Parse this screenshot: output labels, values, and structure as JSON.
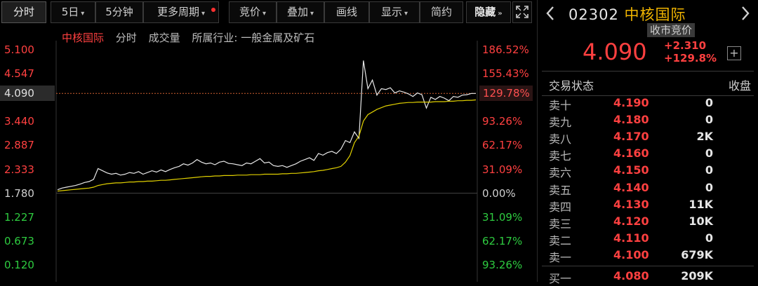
{
  "toolbar": {
    "items": [
      {
        "label": "分时"
      },
      {
        "label": "5日",
        "caret": "▾"
      },
      {
        "label": "5分钟"
      },
      {
        "label": "更多周期",
        "caret": "▾"
      },
      {
        "label": "竞价",
        "caret": "▾"
      },
      {
        "label": "叠加",
        "caret": "▾"
      },
      {
        "label": "画线"
      },
      {
        "label": "显示",
        "caret": "▾"
      },
      {
        "label": "简约"
      },
      {
        "label": "隐藏",
        "caret": "»"
      }
    ],
    "fullscreen_icon": "fullscreen-icon"
  },
  "chart_header": {
    "name": "中核国际",
    "items": [
      "分时",
      "成交量",
      "所属行业: 一般金属及矿石"
    ]
  },
  "chart_data": {
    "type": "line",
    "title": "",
    "prev_close": 1.78,
    "y_left_ticks": [
      "5.100",
      "4.547",
      "3.440",
      "2.887",
      "2.333",
      "1.780",
      "1.227",
      "0.673",
      "0.120"
    ],
    "y_left_values": [
      5.1,
      4.547,
      3.44,
      2.887,
      2.333,
      1.78,
      1.227,
      0.673,
      0.12
    ],
    "y_right_ticks": [
      "186.52%",
      "155.43%",
      "93.26%",
      "62.17%",
      "31.09%",
      "0.00%",
      "31.09%",
      "62.17%",
      "93.26%"
    ],
    "current_price_label": "4.090",
    "current_pct_label": "129.78%",
    "ylim": [
      0.12,
      5.1
    ],
    "series": [
      {
        "color": "#e8e8e8",
        "values": [
          1.86,
          1.9,
          1.92,
          1.94,
          1.96,
          1.99,
          2.03,
          2.05,
          2.1,
          2.35,
          2.3,
          2.25,
          2.22,
          2.24,
          2.2,
          2.22,
          2.26,
          2.24,
          2.28,
          2.22,
          2.26,
          2.3,
          2.27,
          2.32,
          2.28,
          2.33,
          2.37,
          2.4,
          2.46,
          2.43,
          2.48,
          2.56,
          2.5,
          2.46,
          2.48,
          2.44,
          2.5,
          2.52,
          2.47,
          2.46,
          2.44,
          2.42,
          2.48,
          2.46,
          2.52,
          2.58,
          2.48,
          2.5,
          2.42,
          2.4,
          2.42,
          2.38,
          2.42,
          2.46,
          2.52,
          2.56,
          2.6,
          2.54,
          2.7,
          2.66,
          2.72,
          2.75,
          2.7,
          2.8,
          3.0,
          2.95,
          3.2,
          3.05,
          4.85,
          4.2,
          4.4,
          4.05,
          4.2,
          4.18,
          4.22,
          4.1,
          4.15,
          4.12,
          4.08,
          4.02,
          4.1,
          4.06,
          3.75,
          4.0,
          3.95,
          4.02,
          3.98,
          3.92,
          4.02,
          4.0,
          4.05,
          4.06,
          4.09,
          4.09
        ]
      },
      {
        "color": "#e0d000",
        "values": [
          1.83,
          1.84,
          1.85,
          1.86,
          1.87,
          1.88,
          1.89,
          1.9,
          1.92,
          1.96,
          1.98,
          2.0,
          2.01,
          2.02,
          2.02,
          2.03,
          2.04,
          2.04,
          2.05,
          2.05,
          2.06,
          2.06,
          2.07,
          2.08,
          2.08,
          2.09,
          2.1,
          2.11,
          2.12,
          2.13,
          2.14,
          2.15,
          2.16,
          2.17,
          2.17,
          2.18,
          2.18,
          2.19,
          2.19,
          2.19,
          2.2,
          2.2,
          2.2,
          2.21,
          2.21,
          2.21,
          2.22,
          2.22,
          2.22,
          2.22,
          2.23,
          2.23,
          2.24,
          2.24,
          2.25,
          2.26,
          2.27,
          2.28,
          2.3,
          2.31,
          2.33,
          2.35,
          2.37,
          2.4,
          2.5,
          2.65,
          2.95,
          3.1,
          3.45,
          3.6,
          3.66,
          3.72,
          3.76,
          3.8,
          3.82,
          3.84,
          3.86,
          3.87,
          3.88,
          3.88,
          3.89,
          3.89,
          3.89,
          3.89,
          3.9,
          3.9,
          3.9,
          3.91,
          3.91,
          3.92,
          3.92,
          3.93,
          3.93,
          3.94
        ]
      }
    ]
  },
  "panel": {
    "code": "02302",
    "name": "中核国际",
    "status": "收市竞价",
    "price": "4.090",
    "change": "+2.310",
    "change_pct": "+129.8%",
    "trade_status_label": "交易状态",
    "collapse_label": "收盘",
    "order_book": [
      {
        "label": "卖十",
        "price": "4.190",
        "volume": "0"
      },
      {
        "label": "卖九",
        "price": "4.180",
        "volume": "0"
      },
      {
        "label": "卖八",
        "price": "4.170",
        "volume": "2K"
      },
      {
        "label": "卖七",
        "price": "4.160",
        "volume": "0"
      },
      {
        "label": "卖六",
        "price": "4.150",
        "volume": "0"
      },
      {
        "label": "卖五",
        "price": "4.140",
        "volume": "0"
      },
      {
        "label": "卖四",
        "price": "4.130",
        "volume": "11K"
      },
      {
        "label": "卖三",
        "price": "4.120",
        "volume": "10K"
      },
      {
        "label": "卖二",
        "price": "4.110",
        "volume": "0"
      },
      {
        "label": "卖一",
        "price": "4.100",
        "volume": "679K"
      },
      {
        "label": "买一",
        "price": "4.080",
        "volume": "209K"
      }
    ]
  },
  "colors": {
    "up": "#ff4040",
    "down": "#2ecc40",
    "price_line": "#e8e8e8",
    "avg_line": "#e0d000",
    "title_name": "#f0b400"
  }
}
